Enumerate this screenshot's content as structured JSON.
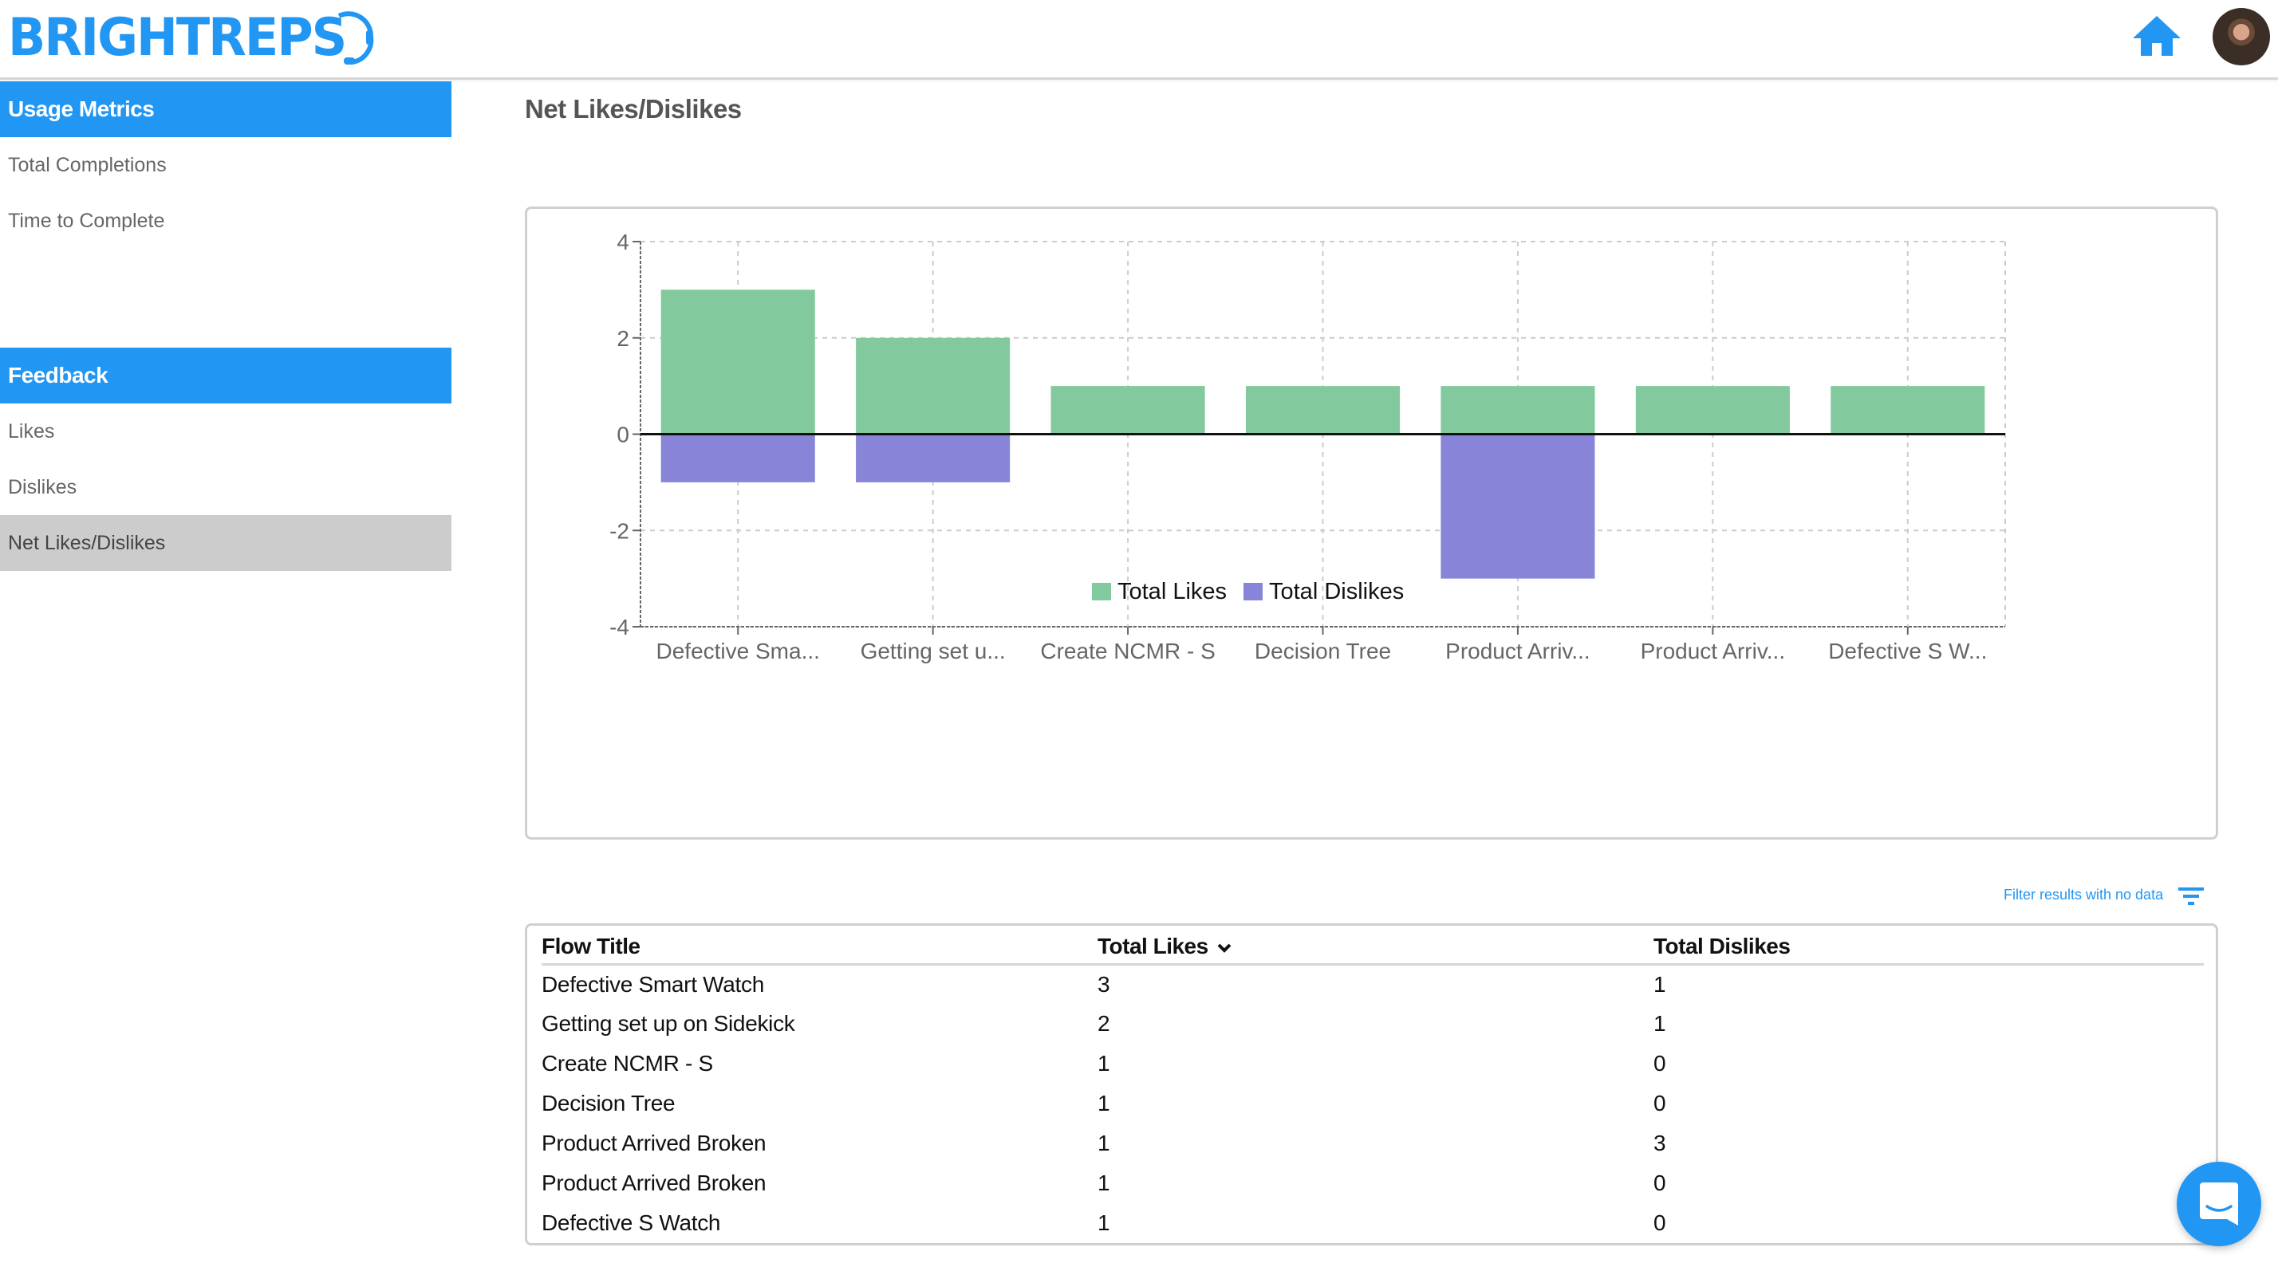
{
  "header": {
    "logo_text": "BRIGHTREPS",
    "home_label": "Home",
    "avatar_label": "User profile"
  },
  "sidebar": {
    "sections": [
      {
        "title": "Usage Metrics",
        "items": [
          {
            "label": "Total Completions"
          },
          {
            "label": "Time to Complete"
          }
        ]
      },
      {
        "title": "Feedback",
        "items": [
          {
            "label": "Likes"
          },
          {
            "label": "Dislikes"
          },
          {
            "label": "Net Likes/Dislikes",
            "active": true
          }
        ]
      }
    ]
  },
  "page": {
    "title": "Net Likes/Dislikes"
  },
  "colors": {
    "accent": "#2196f3",
    "likes": "#82ca9d",
    "dislikes": "#8884d8",
    "active_sidebar": "#cccccc"
  },
  "chart_data": {
    "type": "bar",
    "stacked": true,
    "title": "",
    "xlabel": "",
    "ylabel": "",
    "categories": [
      "Defective Sma...",
      "Getting set u...",
      "Create NCMR - S",
      "Decision Tree",
      "Product Arriv...",
      "Product Arriv...",
      "Defective S W..."
    ],
    "series": [
      {
        "name": "Total Likes",
        "color": "#82ca9d",
        "values": [
          3,
          2,
          1,
          1,
          1,
          1,
          1
        ]
      },
      {
        "name": "Total Dislikes",
        "color": "#8884d8",
        "values": [
          -1,
          -1,
          0,
          0,
          -3,
          0,
          0
        ]
      }
    ],
    "ylim": [
      -4,
      4
    ],
    "yticks": [
      -4,
      -2,
      0,
      2,
      4
    ],
    "grid": true,
    "legend": "bottom-center"
  },
  "filter": {
    "label": "Filter results with no data"
  },
  "table": {
    "columns": [
      {
        "label": "Flow Title"
      },
      {
        "label": "Total Likes",
        "sorted": "desc"
      },
      {
        "label": "Total Dislikes"
      }
    ],
    "rows": [
      [
        "Defective Smart Watch",
        "3",
        "1"
      ],
      [
        "Getting set up on Sidekick",
        "2",
        "1"
      ],
      [
        "Create NCMR - S",
        "1",
        "0"
      ],
      [
        "Decision Tree",
        "1",
        "0"
      ],
      [
        "Product Arrived Broken",
        "1",
        "3"
      ],
      [
        "Product Arrived Broken",
        "1",
        "0"
      ],
      [
        "Defective S Watch",
        "1",
        "0"
      ]
    ]
  },
  "chat": {
    "label": "Open chat"
  }
}
